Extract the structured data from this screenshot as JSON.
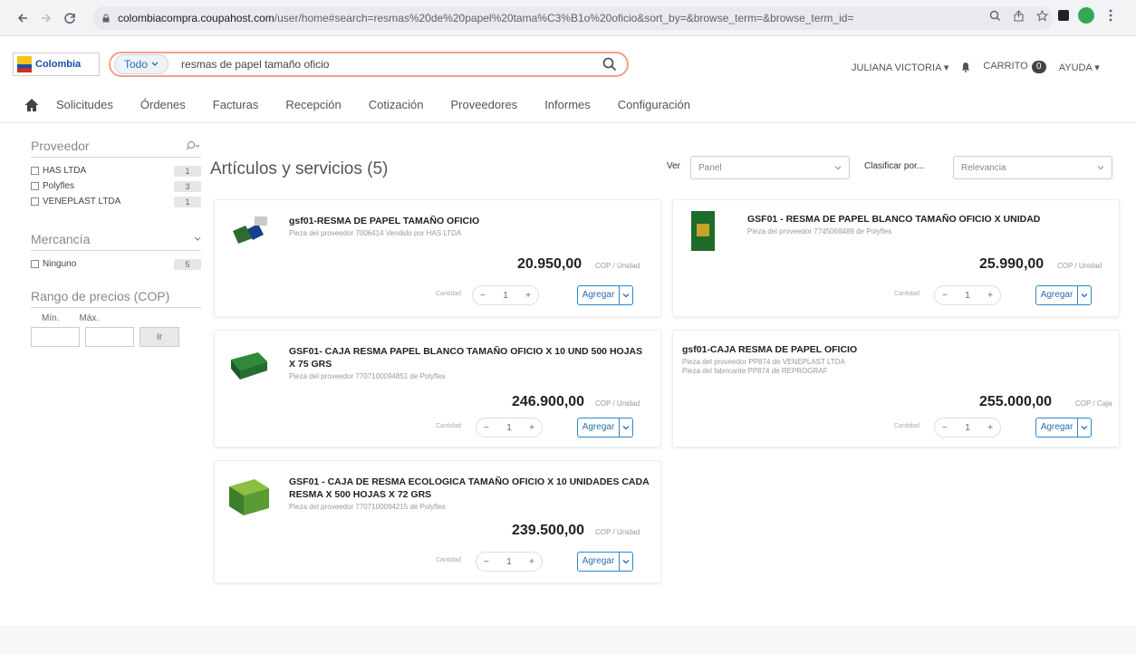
{
  "browser": {
    "url_host": "colombiacompra.coupahost.com",
    "url_path": "/user/home#search=resmas%20de%20papel%20tama%C3%B1o%20oficio&sort_by=&browse_term=&browse_term_id="
  },
  "header": {
    "logo_text": "Colombia",
    "scope_label": "Todo",
    "search_value": "resmas de papel tamaño oficio",
    "user_name": "JULIANA VICTORIA",
    "cart_label": "CARRITO",
    "cart_count": "0",
    "help_label": "AYUDA"
  },
  "menu": {
    "items": [
      {
        "label": "Solicitudes"
      },
      {
        "label": "Órdenes"
      },
      {
        "label": "Facturas"
      },
      {
        "label": "Recepción"
      },
      {
        "label": "Cotización"
      },
      {
        "label": "Proveedores"
      },
      {
        "label": "Informes"
      },
      {
        "label": "Configuración"
      }
    ]
  },
  "sidebar": {
    "supplier_title": "Proveedor",
    "suppliers": [
      {
        "label": "HAS LTDA",
        "count": "1"
      },
      {
        "label": "Polyfles",
        "count": "3"
      },
      {
        "label": "VENEPLAST LTDA",
        "count": "1"
      }
    ],
    "commodity_title": "Mercancía",
    "commodities": [
      {
        "label": "Ninguno",
        "count": "5"
      }
    ],
    "price_title": "Rango de precios (COP)",
    "min_label": "Mín.",
    "max_label": "Máx.",
    "apply_label": "Ir"
  },
  "results": {
    "title": "Artículos y servicios (5)",
    "view_label": "Ver",
    "view_value": "Panel",
    "sort_label": "Clasificar por...",
    "sort_value": "Relevancia",
    "qty_label": "Cantidad",
    "add_label": "Agregar",
    "items": [
      {
        "name": "gsf01-RESMA DE PAPEL TAMAÑO OFICIO",
        "subtitle": "Pieza del proveedor 7006414 Vendido por HAS LTDA",
        "subtitle2": "",
        "price": "20.950,00",
        "unit": "COP / Unidad",
        "qty": "1"
      },
      {
        "name": "GSF01 - RESMA DE PAPEL BLANCO TAMAÑO OFICIO X UNIDAD",
        "subtitle": "Pieza del proveedor 7745068489 de Polyfles",
        "subtitle2": "",
        "price": "25.990,00",
        "unit": "COP / Unidad",
        "qty": "1"
      },
      {
        "name": "GSF01- CAJA RESMA PAPEL BLANCO TAMAÑO OFICIO X 10 UND 500 HOJAS X 75 GRS",
        "subtitle": "Pieza del proveedor 7707100094851 de Polyfles",
        "subtitle2": "",
        "price": "246.900,00",
        "unit": "COP / Unidad",
        "qty": "1"
      },
      {
        "name": "gsf01-CAJA RESMA DE PAPEL OFICIO",
        "subtitle": "Pieza del proveedor PP874 de VENEPLAST LTDA",
        "subtitle2": "Pieza del fabricante PP874 de REPROGRAF",
        "price": "255.000,00",
        "unit": "COP / Caja",
        "qty": "1"
      },
      {
        "name": "GSF01 - CAJA DE RESMA ECOLOGICA TAMAÑO OFICIO X 10 UNIDADES CADA RESMA X 500 HOJAS X 72 GRS",
        "subtitle": "Pieza del proveedor 7707100094215 de Polyfles",
        "subtitle2": "",
        "price": "239.500,00",
        "unit": "COP / Unidad",
        "qty": "1"
      }
    ]
  }
}
